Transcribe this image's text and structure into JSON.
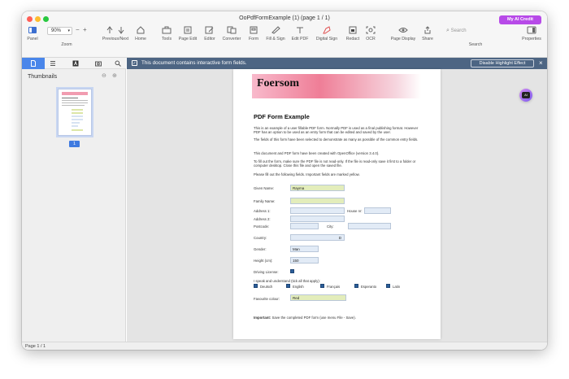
{
  "window": {
    "title": "OoPdfFormExample (1) (page 1 / 1)",
    "credit_button": "My AI Credit",
    "credit_color": "#b74ae8"
  },
  "toolbar": {
    "panel": "Panel",
    "zoom_value": "90%",
    "zoom_label": "Zoom",
    "prev_next": "Previous/Next",
    "home": "Home",
    "tools": "Tools",
    "page_edit": "Page Edit",
    "editor": "Editor",
    "converter": "Converter",
    "form": "Form",
    "fill_sign": "Fill & Sign",
    "edit_pdf": "Edit PDF",
    "digital_sign": "Digital Sign",
    "redact": "Redact",
    "ocr": "OCR",
    "page_display": "Page Display",
    "share": "Share",
    "search_placeholder": "Search",
    "search_label": "Search",
    "properties": "Properties"
  },
  "sidebar": {
    "title": "Thumbnails",
    "page_number": "1"
  },
  "notice": {
    "message": "This document contains interactive form fields.",
    "button": "Disable Highlight Effect"
  },
  "document": {
    "logo": "Foersom",
    "title": "PDF Form Example",
    "p1": "This is an example of a user fillable PDF form. Normally PDF is used as a final publishing format. However PDF has an option to be used as an entry form that can be edited and saved by the user.",
    "p2": "The fields of this form have been selected to demonstrate as many as possible of the common entry fields.",
    "p3": "This document and PDF form have been created with OpenOffice (version 3.4.0).",
    "p4": "To fill out the form, make sure the PDF file is not read-only. If the file is read-only save it first to a folder or computer desktop. Close this file and open the saved file.",
    "p5": "Please fill out the following fields. Important fields are marked yellow.",
    "labels": {
      "given_name": "Given Name:",
      "family_name": "Family Name:",
      "address1": "Address 1:",
      "house_nr": "House nr:",
      "address2": "Address 2:",
      "postcode": "Postcode:",
      "city": "City:",
      "country": "Country:",
      "gender": "Gender:",
      "height": "Height (cm):",
      "driving": "Driving License:",
      "languages": "I speak and understand (tick all that apply):",
      "colour": "Favourite colour:"
    },
    "values": {
      "given_name": "Rayma",
      "family_name": "",
      "address1": "",
      "house_nr": "",
      "address2": "",
      "postcode": "",
      "city": "",
      "country": "D",
      "gender": "Man",
      "height": "150",
      "colour": "Red"
    },
    "languages": [
      "Deutsch",
      "English",
      "Français",
      "Esperanto",
      "Latin"
    ],
    "important_label": "Important:",
    "important_text": "Save the completed PDF form (use menu File - Save)."
  },
  "status": {
    "page": "Page 1 / 1"
  },
  "float_button": "AI"
}
